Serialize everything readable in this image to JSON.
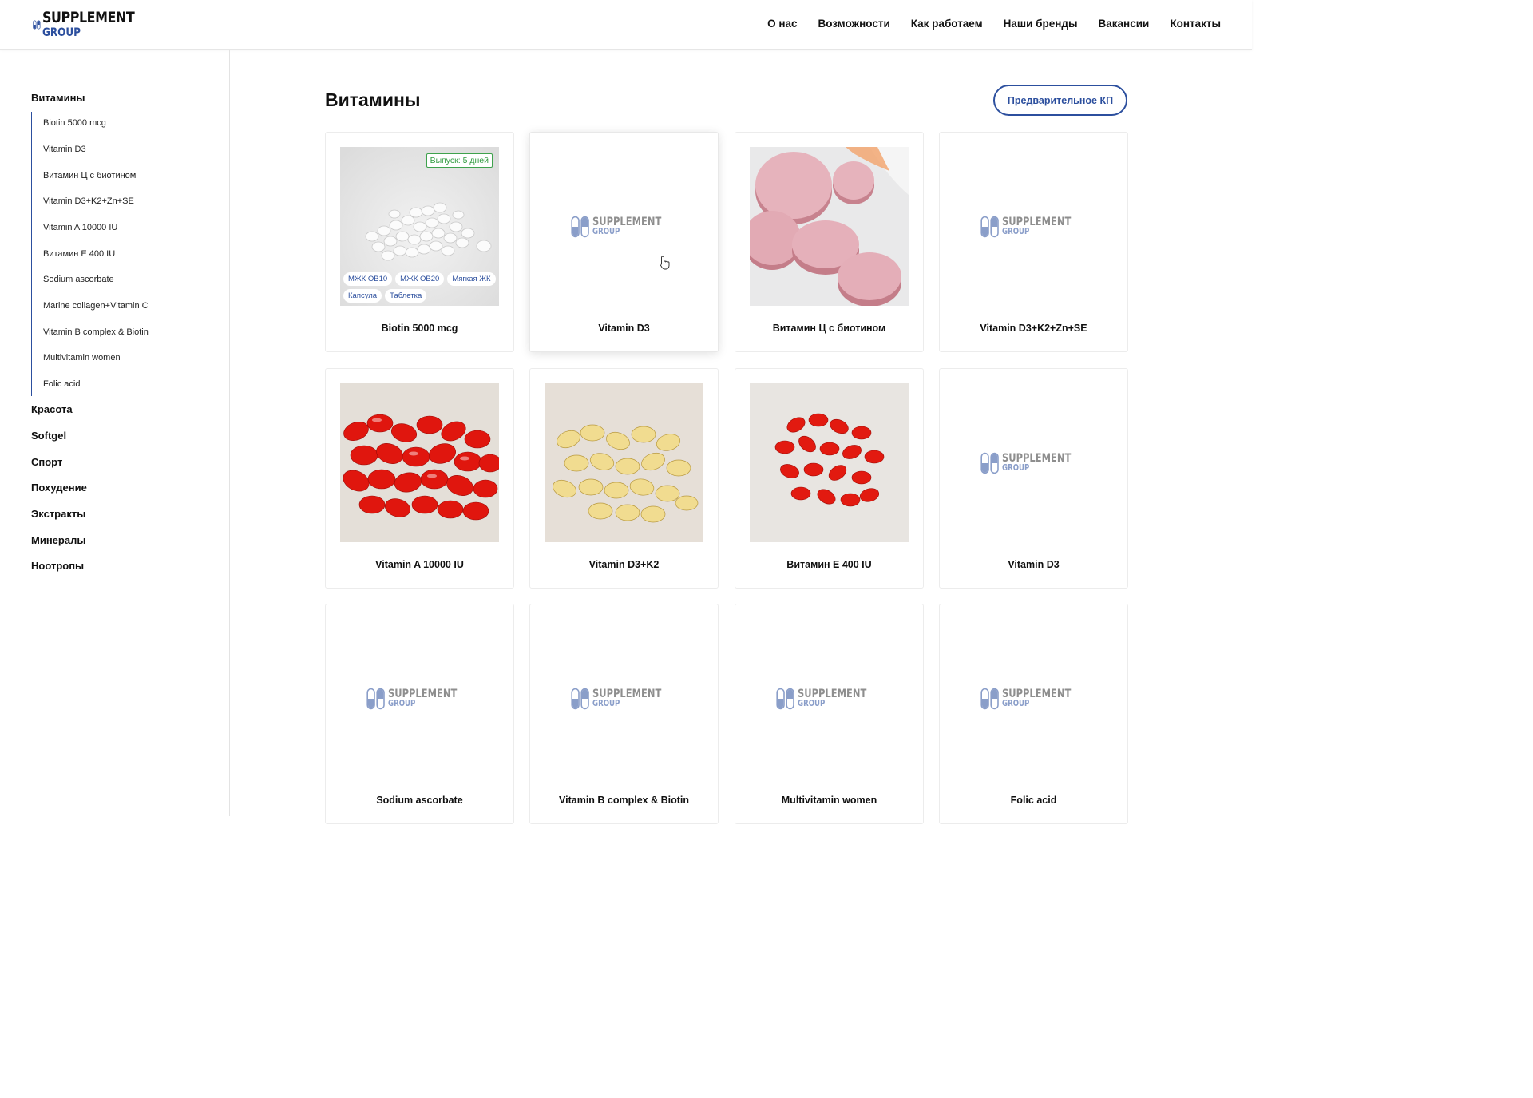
{
  "brand": {
    "line1": "SUPPLEMENT",
    "line2": "GROUP"
  },
  "nav": [
    "О нас",
    "Возможности",
    "Как работаем",
    "Наши бренды",
    "Вакансии",
    "Контакты"
  ],
  "sidebar": {
    "active_category": "Витамины",
    "subitems": [
      "Biotin 5000 mcg",
      "Vitamin D3",
      "Витамин Ц с биотином",
      "Vitamin D3+K2+Zn+SE",
      "Vitamin A 10000 IU",
      "Витамин Е 400 IU",
      "Sodium ascorbate",
      "Marine collagen+Vitamin C",
      "Vitamin B complex & Biotin",
      "Multivitamin women",
      "Folic acid"
    ],
    "categories": [
      "Красота",
      "Softgel",
      "Спорт",
      "Похудение",
      "Экстракты",
      "Минералы",
      "Ноотропы"
    ]
  },
  "main": {
    "title": "Витамины",
    "kp_button": "Предварительное КП",
    "products": [
      {
        "name": "Biotin 5000 mcg",
        "image": "white-tablets",
        "badge": "Выпуск: 5 дней",
        "tags": [
          "МЖК ОВ10",
          "МЖК ОВ20",
          "Мягкая ЖК",
          "Капсула",
          "Таблетка"
        ]
      },
      {
        "name": "Vitamin D3",
        "image": "placeholder-logo"
      },
      {
        "name": "Витамин Ц с биотином",
        "image": "pink-effervescent-tablets"
      },
      {
        "name": "Vitamin D3+K2+Zn+SE",
        "image": "placeholder-logo"
      },
      {
        "name": "Vitamin A 10000 IU",
        "image": "red-softgels"
      },
      {
        "name": "Vitamin D3+K2",
        "image": "yellow-softgels"
      },
      {
        "name": "Витамин Е 400 IU",
        "image": "red-softgels-scattered"
      },
      {
        "name": "Vitamin D3",
        "image": "placeholder-logo"
      },
      {
        "name": "Sodium ascorbate",
        "image": "placeholder-logo"
      },
      {
        "name": "Vitamin B complex & Biotin",
        "image": "placeholder-logo"
      },
      {
        "name": "Multivitamin women",
        "image": "placeholder-logo"
      },
      {
        "name": "Folic acid",
        "image": "placeholder-logo"
      }
    ]
  },
  "colors": {
    "brand_blue": "#2c4f9e",
    "badge_green": "#2f9a3e",
    "border": "#ececec"
  }
}
